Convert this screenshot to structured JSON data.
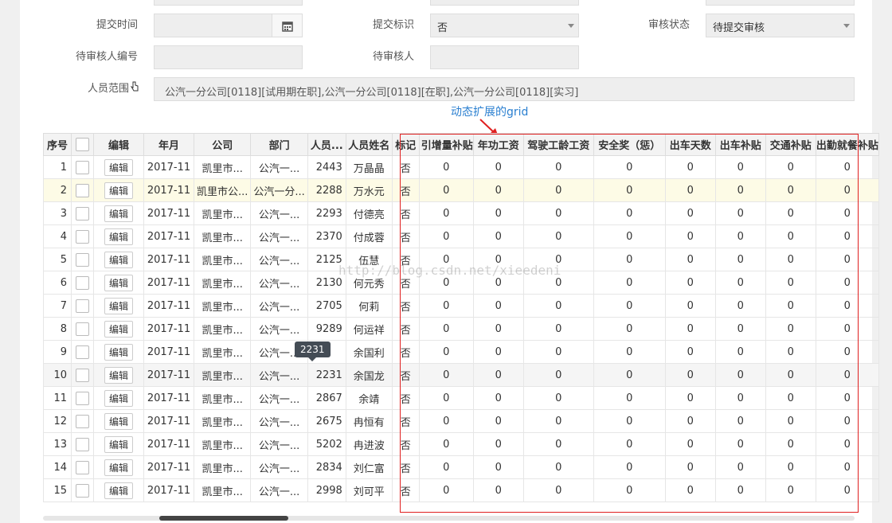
{
  "form": {
    "submit_time_label": "提交时间",
    "submit_flag_label": "提交标识",
    "submit_flag_value": "否",
    "review_status_label": "审核状态",
    "review_status_value": "待提交审核",
    "reviewer_no_label": "待审核人编号",
    "reviewer_label": "待审核人",
    "scope_label": "人员范围",
    "scope_value": "公汽一分公司[0118][试用期在职],公汽一分公司[0118][在职],公汽一分公司[0118][实习]"
  },
  "annotation": "动态扩展的grid",
  "watermark": "http://blog.csdn.net/xieedeni",
  "tooltip": "2231",
  "grid": {
    "columns": [
      "序号",
      "",
      "编辑",
      "年月",
      "公司",
      "部门",
      "人员...",
      "人员姓名",
      "标记",
      "引增量补贴",
      "年功工资",
      "驾驶工龄工资",
      "安全奖（惩）",
      "出车天数",
      "出车补贴",
      "交通补贴",
      "出勤就餐补贴"
    ],
    "edit_label": "编辑",
    "rows": [
      {
        "seq": "1",
        "ym": "2017-11",
        "company": "凯里市...",
        "dept": "公汽一...",
        "empno": "2443",
        "name": "万晶晶",
        "flag": "否",
        "v": [
          "0",
          "0",
          "0",
          "0",
          "0",
          "0",
          "0",
          "0"
        ]
      },
      {
        "seq": "2",
        "ym": "2017-11",
        "company": "凯里市公...",
        "dept": "公汽一分...",
        "empno": "2288",
        "name": "万水元",
        "flag": "否",
        "v": [
          "0",
          "0",
          "0",
          "0",
          "0",
          "0",
          "0",
          "0"
        ]
      },
      {
        "seq": "3",
        "ym": "2017-11",
        "company": "凯里市...",
        "dept": "公汽一...",
        "empno": "2293",
        "name": "付德亮",
        "flag": "否",
        "v": [
          "0",
          "0",
          "0",
          "0",
          "0",
          "0",
          "0",
          "0"
        ]
      },
      {
        "seq": "4",
        "ym": "2017-11",
        "company": "凯里市...",
        "dept": "公汽一...",
        "empno": "2370",
        "name": "付成蓉",
        "flag": "否",
        "v": [
          "0",
          "0",
          "0",
          "0",
          "0",
          "0",
          "0",
          "0"
        ]
      },
      {
        "seq": "5",
        "ym": "2017-11",
        "company": "凯里市...",
        "dept": "公汽一...",
        "empno": "2125",
        "name": "伍慧",
        "flag": "否",
        "v": [
          "0",
          "0",
          "0",
          "0",
          "0",
          "0",
          "0",
          "0"
        ]
      },
      {
        "seq": "6",
        "ym": "2017-11",
        "company": "凯里市...",
        "dept": "公汽一...",
        "empno": "2130",
        "name": "何元秀",
        "flag": "否",
        "v": [
          "0",
          "0",
          "0",
          "0",
          "0",
          "0",
          "0",
          "0"
        ]
      },
      {
        "seq": "7",
        "ym": "2017-11",
        "company": "凯里市...",
        "dept": "公汽一...",
        "empno": "2705",
        "name": "何莉",
        "flag": "否",
        "v": [
          "0",
          "0",
          "0",
          "0",
          "0",
          "0",
          "0",
          "0"
        ]
      },
      {
        "seq": "8",
        "ym": "2017-11",
        "company": "凯里市...",
        "dept": "公汽一...",
        "empno": "9289",
        "name": "何运祥",
        "flag": "否",
        "v": [
          "0",
          "0",
          "0",
          "0",
          "0",
          "0",
          "0",
          "0"
        ]
      },
      {
        "seq": "9",
        "ym": "2017-11",
        "company": "凯里市...",
        "dept": "公汽一...",
        "empno": "",
        "name": "余国利",
        "flag": "否",
        "v": [
          "0",
          "0",
          "0",
          "0",
          "0",
          "0",
          "0",
          "0"
        ]
      },
      {
        "seq": "10",
        "ym": "2017-11",
        "company": "凯里市...",
        "dept": "公汽一...",
        "empno": "2231",
        "name": "余国龙",
        "flag": "否",
        "v": [
          "0",
          "0",
          "0",
          "0",
          "0",
          "0",
          "0",
          "0"
        ]
      },
      {
        "seq": "11",
        "ym": "2017-11",
        "company": "凯里市...",
        "dept": "公汽一...",
        "empno": "2867",
        "name": "余靖",
        "flag": "否",
        "v": [
          "0",
          "0",
          "0",
          "0",
          "0",
          "0",
          "0",
          "0"
        ]
      },
      {
        "seq": "12",
        "ym": "2017-11",
        "company": "凯里市...",
        "dept": "公汽一...",
        "empno": "2675",
        "name": "冉恒有",
        "flag": "否",
        "v": [
          "0",
          "0",
          "0",
          "0",
          "0",
          "0",
          "0",
          "0"
        ]
      },
      {
        "seq": "13",
        "ym": "2017-11",
        "company": "凯里市...",
        "dept": "公汽一...",
        "empno": "5202",
        "name": "冉进波",
        "flag": "否",
        "v": [
          "0",
          "0",
          "0",
          "0",
          "0",
          "0",
          "0",
          "0"
        ]
      },
      {
        "seq": "14",
        "ym": "2017-11",
        "company": "凯里市...",
        "dept": "公汽一...",
        "empno": "2834",
        "name": "刘仁富",
        "flag": "否",
        "v": [
          "0",
          "0",
          "0",
          "0",
          "0",
          "0",
          "0",
          "0"
        ]
      },
      {
        "seq": "15",
        "ym": "2017-11",
        "company": "凯里市...",
        "dept": "公汽一...",
        "empno": "2998",
        "name": "刘可平",
        "flag": "否",
        "v": [
          "0",
          "0",
          "0",
          "0",
          "0",
          "0",
          "0",
          "0"
        ]
      }
    ]
  },
  "colors": {
    "highlight_row": "#fdfbe6",
    "annotation": "#2a7fd0",
    "red_box": "#e02020"
  }
}
